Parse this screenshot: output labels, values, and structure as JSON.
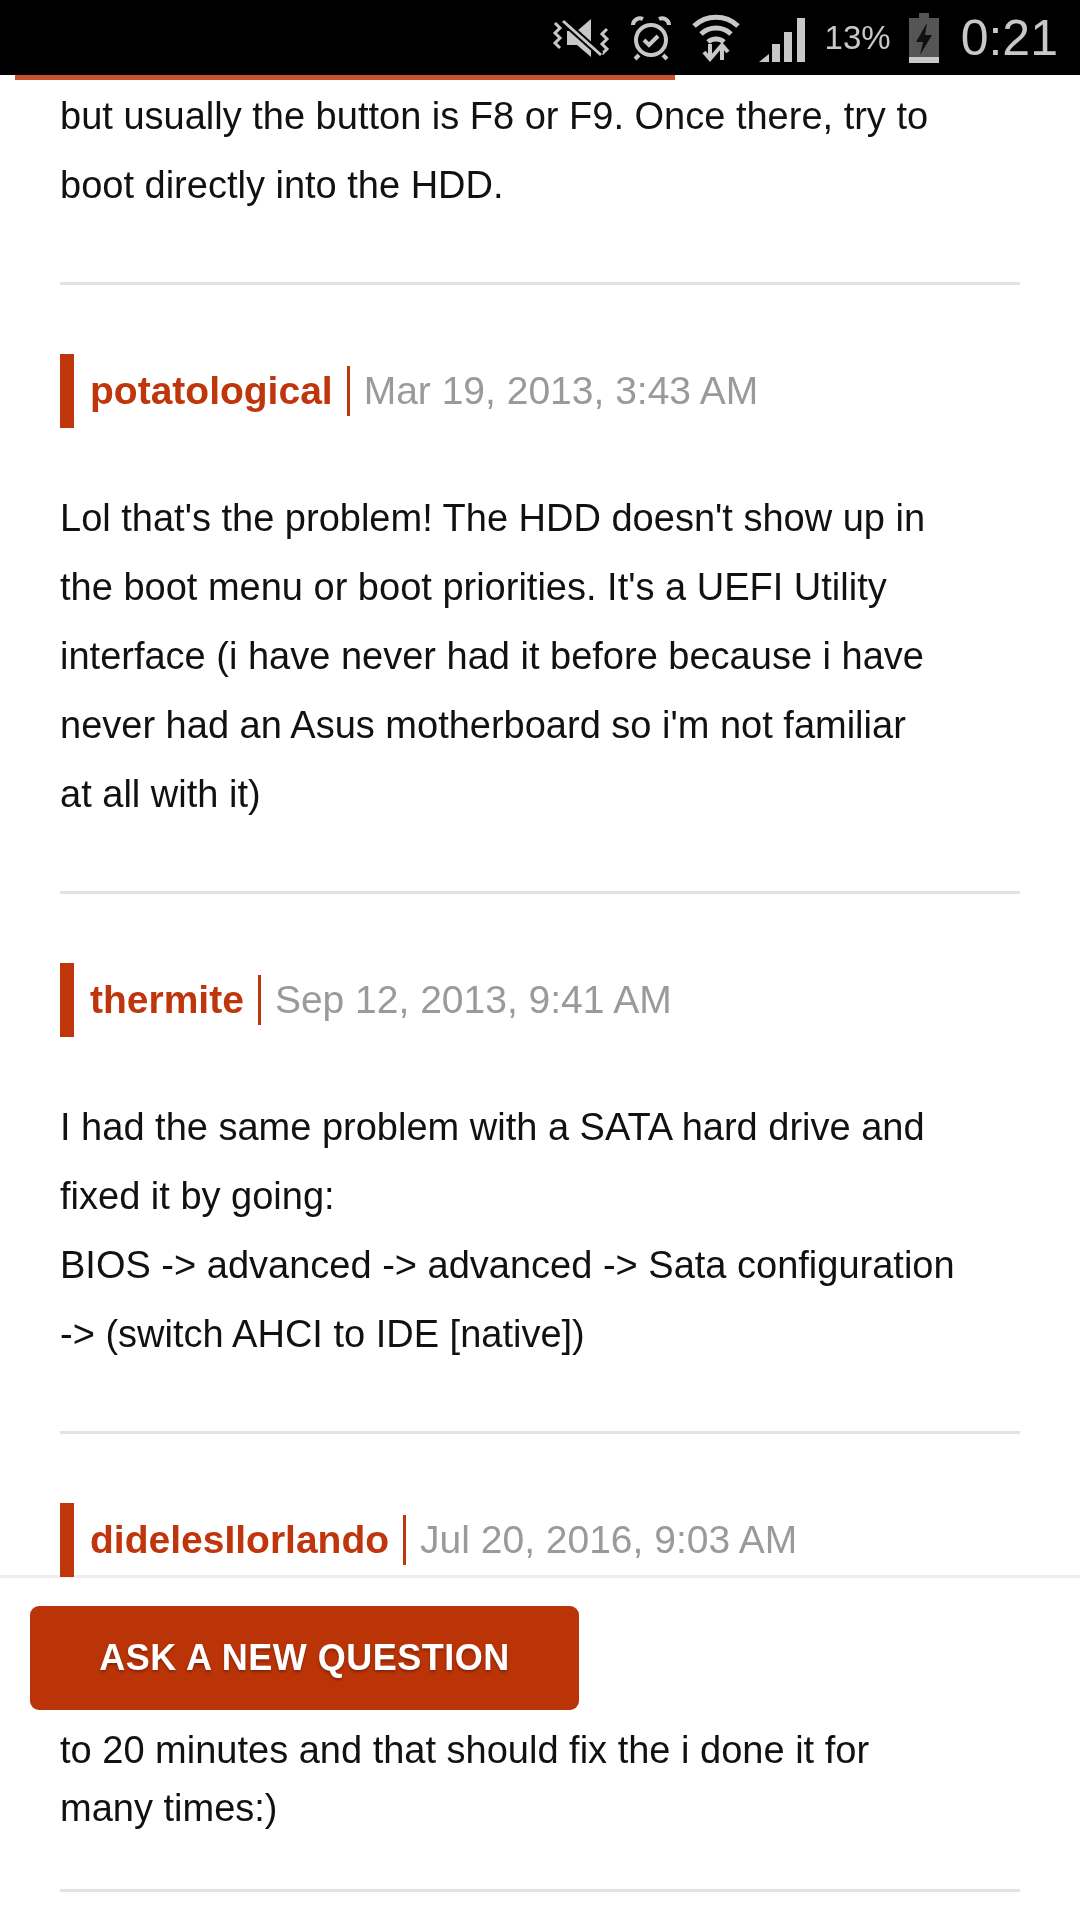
{
  "status_bar": {
    "battery": "13%",
    "time": "0:21"
  },
  "reading_progress": {
    "level": 0.62
  },
  "posts": [
    {
      "body": "but usually the button is F8 or F9. Once there, try to\nboot directly into the HDD."
    },
    {
      "author": "potatological",
      "date": "Mar 19, 2013, 3:43 AM",
      "body": "Lol that's the problem! The HDD doesn't show up in\nthe boot menu or boot priorities. It's a UEFI Utility\ninterface (i have never had it before because i have\nnever had an Asus motherboard so i'm not familiar\nat all with it)"
    },
    {
      "author": "thermite",
      "date": "Sep 12, 2013, 9:41 AM",
      "body": "I had the same problem with a SATA hard drive and\nfixed it by going:\nBIOS -> advanced -> advanced -> Sata configuration\n-> (switch AHCI to IDE [native])"
    }
  ],
  "last_post": {
    "author": "didelesIlorlando",
    "date": "Jul 20, 2016, 9:03 AM",
    "body_partial": "to 20 minutes and that should fix the i done it for",
    "body": "many times:)"
  },
  "ask_button": "ASK A NEW QUESTION"
}
